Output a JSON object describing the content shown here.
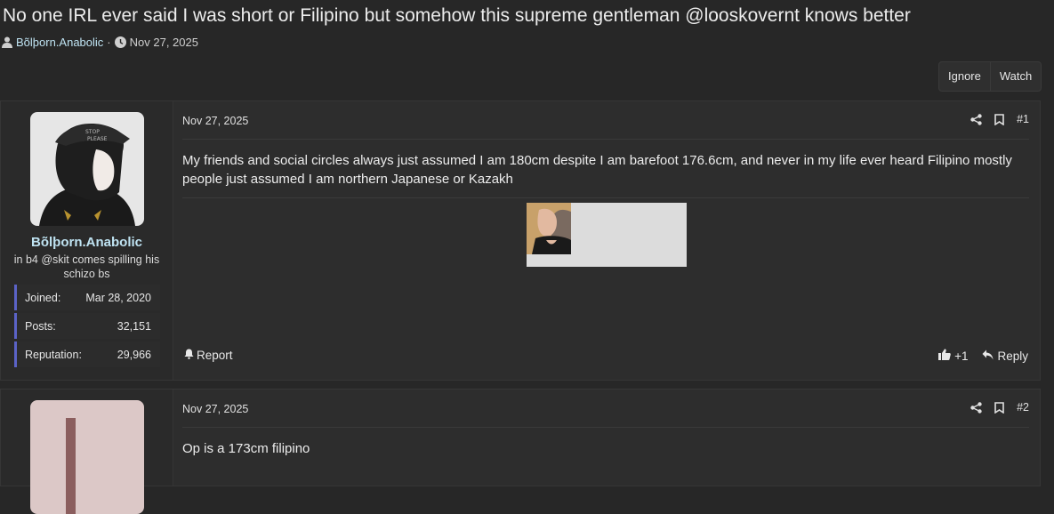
{
  "thread": {
    "title": "No one IRL ever said I was short or Filipino but somehow this supreme gentleman @looskovernt knows better",
    "author": "Bõlþorn.Anabolic",
    "date": "Nov 27, 2025",
    "separator": "·"
  },
  "toolbar": {
    "ignore_label": "Ignore",
    "watch_label": "Watch"
  },
  "posts": [
    {
      "date": "Nov 27, 2025",
      "number": "#1",
      "body": "My friends and social circles always just assumed I am 180cm despite I am barefoot 176.6cm, and never in my life ever heard Filipino mostly people just assumed I am northern Japanese or Kazakh",
      "user": {
        "name": "Bõlþorn.Anabolic",
        "title": "in b4 @skit comes spilling his schizo bs",
        "stats": [
          {
            "label": "Joined:",
            "value": "Mar 28, 2020"
          },
          {
            "label": "Posts:",
            "value": "32,151"
          },
          {
            "label": "Reputation:",
            "value": "29,966"
          }
        ]
      },
      "report_label": "Report",
      "reaction_count": "+1",
      "reply_label": "Reply"
    },
    {
      "date": "Nov 27, 2025",
      "number": "#2",
      "body": "Op is a 173cm filipino",
      "avatar_letter": "I"
    }
  ],
  "icons": {
    "user": "user-icon",
    "clock": "clock-icon",
    "share": "share-icon",
    "bookmark": "bookmark-icon",
    "bell": "bell-icon",
    "thumbs_up": "thumbs-up-icon",
    "reply": "reply-icon"
  },
  "colors": {
    "background": "#272727",
    "username": "#bfe3f2",
    "stat_accent": "#5b63c7",
    "avatar2_bg": "#dcc8c7",
    "avatar2_letter": "#8b5e5e"
  }
}
